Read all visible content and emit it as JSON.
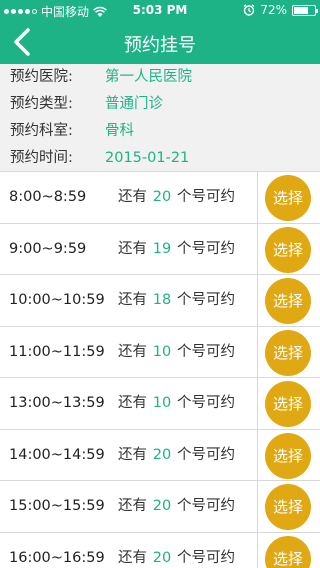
{
  "status_bar": {
    "carrier": "中国移动",
    "time": "5:03 PM",
    "battery_text": "72%",
    "battery_level": 0.72
  },
  "navbar": {
    "title": "预约挂号",
    "back_icon": "chevron-left-icon"
  },
  "info": {
    "hospital_label": "预约医院:",
    "hospital_value": "第一人民医院",
    "type_label": "预约类型:",
    "type_value": "普通门诊",
    "department_label": "预约科室:",
    "department_value": "骨科",
    "date_label": "预约时间:",
    "date_value": "2015-01-21"
  },
  "slot_text": {
    "prefix": "还有",
    "suffix": "个号可约",
    "button_label": "选择"
  },
  "slots": [
    {
      "time": "8:00~8:59",
      "count": "20"
    },
    {
      "time": "9:00~9:59",
      "count": "19"
    },
    {
      "time": "10:00~10:59",
      "count": "18"
    },
    {
      "time": "11:00~11:59",
      "count": "10"
    },
    {
      "time": "13:00~13:59",
      "count": "10"
    },
    {
      "time": "14:00~14:59",
      "count": "20"
    },
    {
      "time": "15:00~15:59",
      "count": "20"
    },
    {
      "time": "16:00~16:59",
      "count": "20"
    }
  ],
  "colors": {
    "primary_green": "#1db387",
    "select_orange": "#e0a812",
    "info_background": "#f1f1f1"
  }
}
